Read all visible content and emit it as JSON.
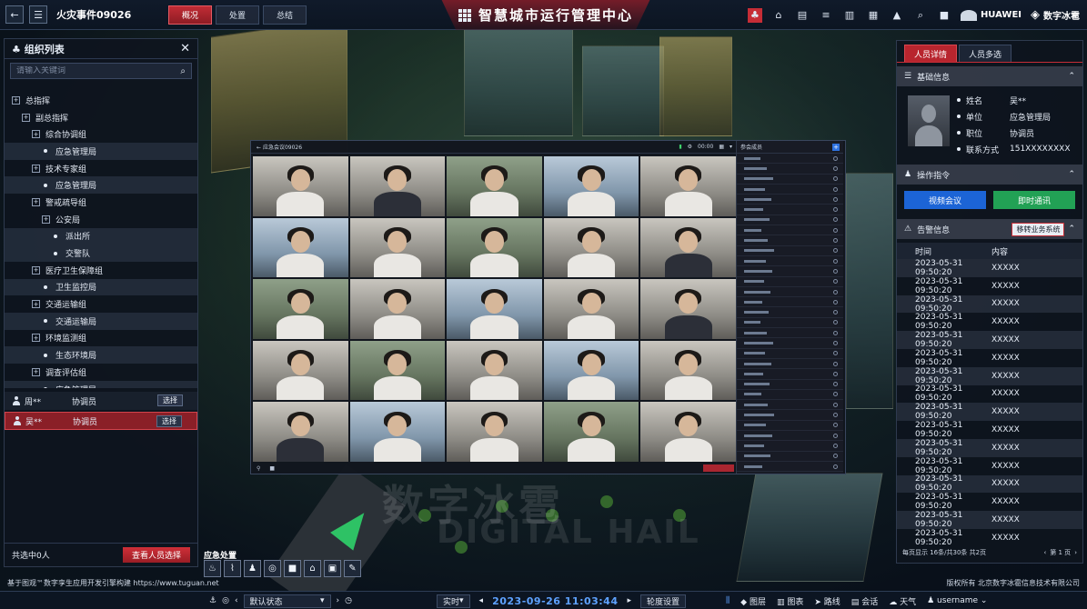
{
  "topbar": {
    "event_title": "火灾事件09026",
    "tabs": [
      {
        "label": "概况",
        "active": true
      },
      {
        "label": "处置",
        "active": false
      },
      {
        "label": "总结",
        "active": false
      }
    ],
    "center_title": "智慧城市运行管理中心",
    "brand_huawei": "HUAWEI",
    "brand_digital": "数字冰雹",
    "accent_color": "#c62d36"
  },
  "left_panel": {
    "title": "组织列表",
    "search_placeholder": "请输入关键词",
    "tree": [
      {
        "label": "总指挥",
        "type": "box",
        "level": 0
      },
      {
        "label": "副总指挥",
        "type": "box",
        "level": 1
      },
      {
        "label": "综合协调组",
        "type": "box",
        "level": 2
      },
      {
        "label": "应急管理局",
        "type": "dot",
        "level": 3
      },
      {
        "label": "技术专家组",
        "type": "box",
        "level": 2
      },
      {
        "label": "应急管理局",
        "type": "dot",
        "level": 3
      },
      {
        "label": "警戒疏导组",
        "type": "box",
        "level": 2
      },
      {
        "label": "公安局",
        "type": "box",
        "level": 3
      },
      {
        "label": "派出所",
        "type": "dot",
        "level": 4
      },
      {
        "label": "交警队",
        "type": "dot",
        "level": 4
      },
      {
        "label": "医疗卫生保障组",
        "type": "box",
        "level": 2
      },
      {
        "label": "卫生监控局",
        "type": "dot",
        "level": 3
      },
      {
        "label": "交通运输组",
        "type": "box",
        "level": 2
      },
      {
        "label": "交通运输局",
        "type": "dot",
        "level": 3
      },
      {
        "label": "环境监测组",
        "type": "box",
        "level": 2
      },
      {
        "label": "生态环境局",
        "type": "dot",
        "level": 3
      },
      {
        "label": "调查评估组",
        "type": "box",
        "level": 2
      },
      {
        "label": "应急管理局",
        "type": "dot",
        "level": 3
      }
    ],
    "people": [
      {
        "name": "周**",
        "role": "协调员",
        "button": "选择",
        "selected": false
      },
      {
        "name": "吴**",
        "role": "协调员",
        "button": "选择",
        "selected": true
      }
    ],
    "footer_count": "共选中0人",
    "view_button": "查看人员选择"
  },
  "video": {
    "title": "应急会议09026",
    "time": "00:00",
    "side_title": "参会成员"
  },
  "right_panel": {
    "tabs": [
      {
        "label": "人员详情",
        "active": true
      },
      {
        "label": "人员多选",
        "active": false
      }
    ],
    "basic_info_title": "基础信息",
    "fields": [
      {
        "key": "姓名",
        "value": "吴**"
      },
      {
        "key": "单位",
        "value": "应急管理局"
      },
      {
        "key": "职位",
        "value": "协调员"
      },
      {
        "key": "联系方式",
        "value": "151XXXXXXXX"
      }
    ],
    "ops_title": "操作指令",
    "btn_video": "视频会议",
    "btn_chat": "即时通讯",
    "alert_title": "告警信息",
    "transfer_button": "移转业务系统",
    "col_time": "时间",
    "col_content": "内容",
    "alerts": [
      {
        "time": "2023-05-31 09:50:20",
        "content": "XXXXX"
      },
      {
        "time": "2023-05-31 09:50:20",
        "content": "XXXXX"
      },
      {
        "time": "2023-05-31 09:50:20",
        "content": "XXXXX"
      },
      {
        "time": "2023-05-31 09:50:20",
        "content": "XXXXX"
      },
      {
        "time": "2023-05-31 09:50:20",
        "content": "XXXXX"
      },
      {
        "time": "2023-05-31 09:50:20",
        "content": "XXXXX"
      },
      {
        "time": "2023-05-31 09:50:20",
        "content": "XXXXX"
      },
      {
        "time": "2023-05-31 09:50:20",
        "content": "XXXXX"
      },
      {
        "time": "2023-05-31 09:50:20",
        "content": "XXXXX"
      },
      {
        "time": "2023-05-31 09:50:20",
        "content": "XXXXX"
      },
      {
        "time": "2023-05-31 09:50:20",
        "content": "XXXXX"
      },
      {
        "time": "2023-05-31 09:50:20",
        "content": "XXXXX"
      },
      {
        "time": "2023-05-31 09:50:20",
        "content": "XXXXX"
      },
      {
        "time": "2023-05-31 09:50:20",
        "content": "XXXXX"
      },
      {
        "time": "2023-05-31 09:50:20",
        "content": "XXXXX"
      },
      {
        "time": "2023-05-31 09:50:20",
        "content": "XXXXX"
      }
    ],
    "pagination_info": "每页显示 16条/共30条  共2页",
    "page_current": "第 1 页"
  },
  "tools": {
    "label": "应急处置"
  },
  "credits": {
    "left": "基于图观™数字孪生应用开发引擎构建  https://www.tuguan.net",
    "right": "版权所有  北京数字冰雹信息技术有限公司"
  },
  "bottombar": {
    "state": "默认状态",
    "mode": "实时",
    "datetime": "2023-09-26 11:03:44",
    "settings": "轮度设置",
    "layer": "图层",
    "chart": "图表",
    "route": "路线",
    "meeting": "会话",
    "weather": "天气",
    "username": "username"
  },
  "watermark": {
    "cn": "数字冰雹",
    "en": "DIGITAL HAIL"
  }
}
